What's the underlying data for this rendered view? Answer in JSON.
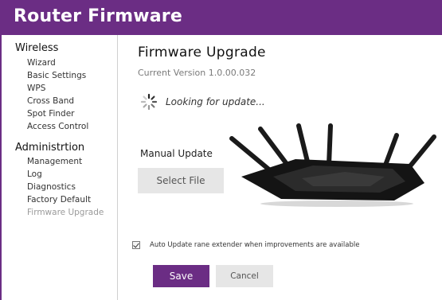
{
  "header": {
    "title": "Router Firmware"
  },
  "sidebar": {
    "sections": [
      {
        "title": "Wireless",
        "items": [
          "Wizard",
          "Basic Settings",
          "WPS",
          "Cross Band",
          "Spot Finder",
          "Access Control"
        ]
      },
      {
        "title": "Administrtion",
        "items": [
          "Management",
          "Log",
          "Diagnostics",
          "Factory Default",
          "Firmware Upgrade"
        ]
      }
    ],
    "active_item": "Firmware Upgrade"
  },
  "main": {
    "title": "Firmware Upgrade",
    "current_version": "Current Version 1.0.00.032",
    "status_text": "Looking for update...",
    "manual_update_label": "Manual Update",
    "select_file_label": "Select File",
    "auto_update": {
      "label": "Auto Update rane extender when improvements are available",
      "checked": true
    },
    "save_label": "Save",
    "cancel_label": "Cancel"
  },
  "colors": {
    "brand": "#6b2d84",
    "button_gray": "#e6e6e6",
    "active_nav": "#9a9a9a"
  },
  "icons": {
    "spinner": "loading-spinner-icon",
    "router": "router-image"
  }
}
